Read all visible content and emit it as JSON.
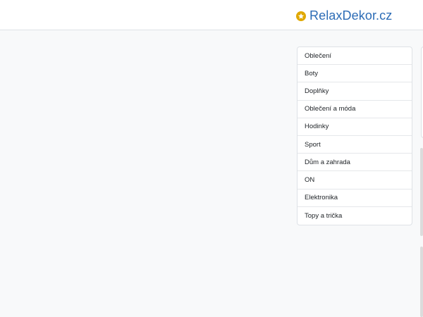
{
  "header": {
    "brand": "RelaxDekor.cz",
    "brand_icon": "star-badge-icon",
    "brand_color": "#2c6cb6",
    "icon_color": "#e0a800"
  },
  "menu": {
    "items": [
      {
        "label": "Oblečení"
      },
      {
        "label": "Boty"
      },
      {
        "label": "Doplňky"
      },
      {
        "label": "Oblečení a móda"
      },
      {
        "label": "Hodinky"
      },
      {
        "label": "Sport"
      },
      {
        "label": "Dům a zahrada"
      },
      {
        "label": "ON"
      },
      {
        "label": "Elektronika"
      },
      {
        "label": "Topy a trička"
      }
    ]
  }
}
